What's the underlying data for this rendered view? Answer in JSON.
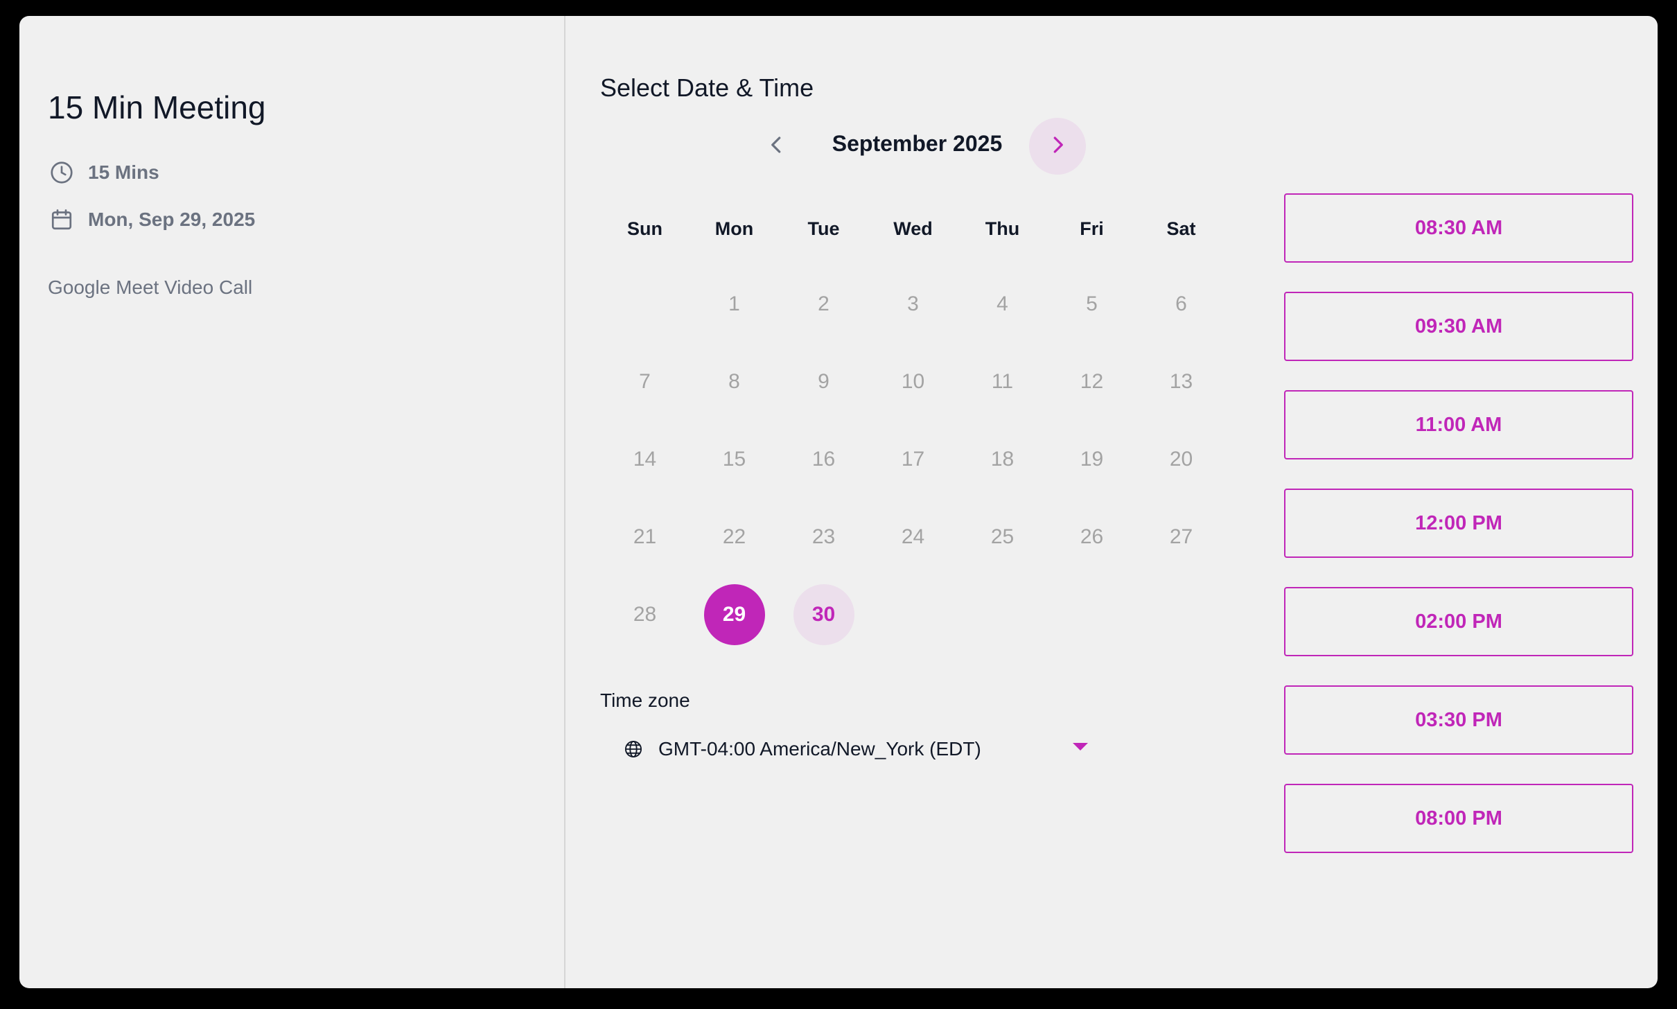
{
  "event": {
    "title": "15 Min Meeting",
    "duration": "15 Mins",
    "date": "Mon, Sep 29, 2025",
    "location": "Google Meet Video Call"
  },
  "scheduler": {
    "title": "Select Date & Time",
    "month_label": "September 2025",
    "weekdays": [
      "Sun",
      "Mon",
      "Tue",
      "Wed",
      "Thu",
      "Fri",
      "Sat"
    ],
    "first_weekday_index": 1,
    "days_in_month": 30,
    "selected_day": 29,
    "available_days": [
      30
    ]
  },
  "timezone": {
    "label": "Time zone",
    "value": "GMT-04:00 America/New_York (EDT)"
  },
  "time_slots": [
    "08:30 AM",
    "09:30 AM",
    "11:00 AM",
    "12:00 PM",
    "02:00 PM",
    "03:30 PM",
    "08:00 PM"
  ],
  "colors": {
    "accent": "#c026b8",
    "accent_soft": "#ecdfec",
    "muted_day": "#a3a3a3",
    "text_primary": "#111827",
    "text_secondary": "#6b7280"
  },
  "icons": {
    "duration": "clock-icon",
    "date": "calendar-icon",
    "timezone": "globe-icon",
    "prev": "chevron-left-icon",
    "next": "chevron-right-icon",
    "dropdown": "caret-down-icon"
  }
}
